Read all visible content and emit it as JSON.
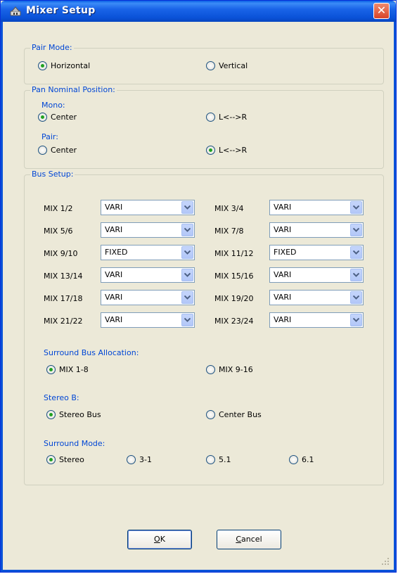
{
  "window": {
    "title": "Mixer Setup",
    "close_glyph": "✕"
  },
  "pair_mode": {
    "label": "Pair Mode:",
    "options": [
      {
        "label": "Horizontal",
        "checked": true
      },
      {
        "label": "Vertical",
        "checked": false
      }
    ]
  },
  "pan": {
    "label": "Pan Nominal Position:",
    "mono_label": "Mono:",
    "mono_options": [
      {
        "label": "Center",
        "checked": true
      },
      {
        "label": "L<-->R",
        "checked": false
      }
    ],
    "pair_label": "Pair:",
    "pair_options": [
      {
        "label": "Center",
        "checked": false
      },
      {
        "label": "L<-->R",
        "checked": true
      }
    ]
  },
  "bus_setup": {
    "label": "Bus Setup:",
    "rows": [
      {
        "left": {
          "label": "MIX 1/2",
          "value": "VARI"
        },
        "right": {
          "label": "MIX 3/4",
          "value": "VARI"
        }
      },
      {
        "left": {
          "label": "MIX 5/6",
          "value": "VARI"
        },
        "right": {
          "label": "MIX 7/8",
          "value": "VARI"
        }
      },
      {
        "left": {
          "label": "MIX 9/10",
          "value": "FIXED"
        },
        "right": {
          "label": "MIX 11/12",
          "value": "FIXED"
        }
      },
      {
        "left": {
          "label": "MIX 13/14",
          "value": "VARI"
        },
        "right": {
          "label": "MIX 15/16",
          "value": "VARI"
        }
      },
      {
        "left": {
          "label": "MIX 17/18",
          "value": "VARI"
        },
        "right": {
          "label": "MIX 19/20",
          "value": "VARI"
        }
      },
      {
        "left": {
          "label": "MIX 21/22",
          "value": "VARI"
        },
        "right": {
          "label": "MIX 23/24",
          "value": "VARI"
        }
      }
    ],
    "surround_alloc": {
      "label": "Surround Bus Allocation:",
      "options": [
        {
          "label": "MIX 1-8",
          "checked": true
        },
        {
          "label": "MIX 9-16",
          "checked": false
        }
      ]
    },
    "stereo_b": {
      "label": "Stereo B:",
      "options": [
        {
          "label": "Stereo Bus",
          "checked": true
        },
        {
          "label": "Center Bus",
          "checked": false
        }
      ]
    },
    "surround_mode": {
      "label": "Surround Mode:",
      "options": [
        {
          "label": "Stereo",
          "checked": true
        },
        {
          "label": "3-1",
          "checked": false
        },
        {
          "label": "5.1",
          "checked": false
        },
        {
          "label": "6.1",
          "checked": false
        }
      ]
    }
  },
  "buttons": {
    "ok_mnemonic": "O",
    "ok_rest": "K",
    "cancel_mnemonic": "C",
    "cancel_rest": "ancel"
  },
  "colors": {
    "title_bar": "#0a52d8",
    "group_label": "#0046d5",
    "radio_dot": "#21a121",
    "face": "#ece9d8"
  }
}
